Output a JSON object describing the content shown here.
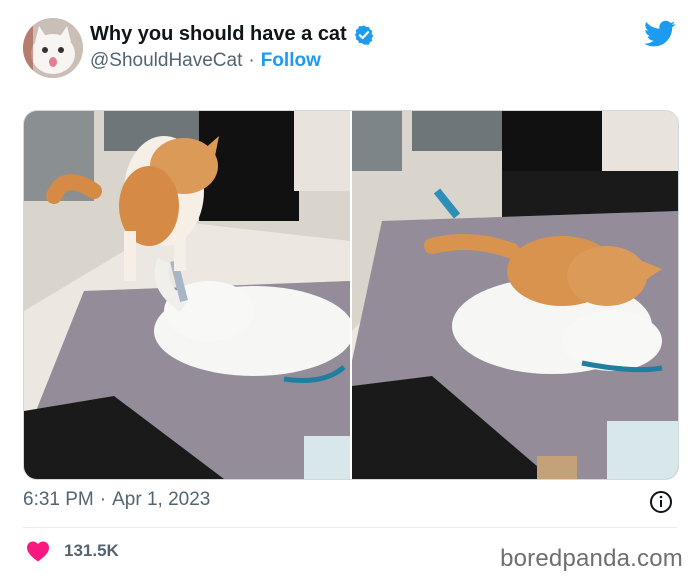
{
  "tweet": {
    "display_name": "Why you should have a cat",
    "handle": "@ShouldHaveCat",
    "follow_label": "Follow",
    "time": "6:31 PM",
    "date": "Apr 1, 2023",
    "separator": "·",
    "likes": "131.5K"
  },
  "watermark": "boredpanda.com",
  "colors": {
    "brand": "#1d9bf0",
    "verified": "#1d9bf0",
    "heart": "#f91880",
    "secondary_text": "#536471"
  },
  "icons": {
    "logo": "twitter-bird-icon",
    "verified": "verified-badge-icon",
    "info": "info-icon",
    "like": "heart-icon"
  }
}
